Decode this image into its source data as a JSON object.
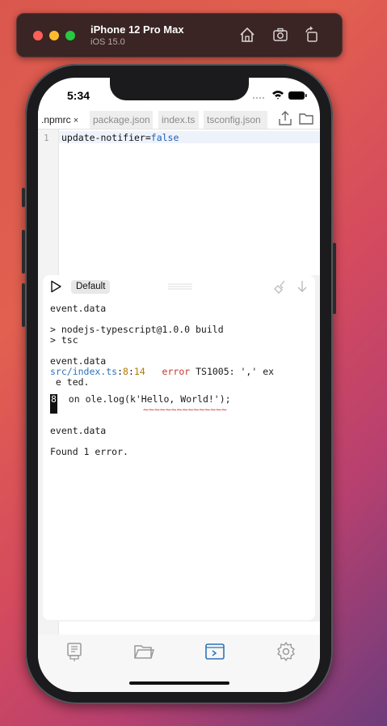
{
  "simulator": {
    "device_name": "iPhone 12 Pro Max",
    "os_version": "iOS 15.0",
    "icons": [
      "home-icon",
      "screenshot-icon",
      "rotate-icon"
    ]
  },
  "status_bar": {
    "time": "5:34"
  },
  "tabs": [
    {
      "label": ".npmrc",
      "close": "×",
      "active": true
    },
    {
      "label": "package.json",
      "active": false
    },
    {
      "label": "index.ts",
      "active": false
    },
    {
      "label": "tsconfig.json",
      "active": false
    }
  ],
  "editor": {
    "line_number": "1",
    "code_key": "update-notifier=",
    "code_value": "false"
  },
  "console": {
    "scheme": "Default",
    "lines": {
      "l1": "event.data",
      "l2": "> nodejs-typescript@1.0.0 build",
      "l3": "> tsc",
      "l4": "event.data",
      "err_file": "src/index.ts",
      "colon1": ":",
      "err_line": "8",
      "colon2": ":",
      "err_col": "14",
      "err_word": "error",
      "err_msg": "TS1005: ',' ex",
      "err_msg2": " e ted.",
      "src_lineno": "8",
      "src_code": "on ole.log(k'Hello, World!');",
      "squiggle": "~~~~~~~~~~~~~~~",
      "l5": "event.data",
      "l6": "Found 1 error."
    }
  },
  "bottom_nav": [
    "explorer-icon",
    "folder-icon",
    "terminal-icon",
    "settings-icon"
  ],
  "colors": {
    "accent": "#2d73b8",
    "error": "#c0392b"
  }
}
